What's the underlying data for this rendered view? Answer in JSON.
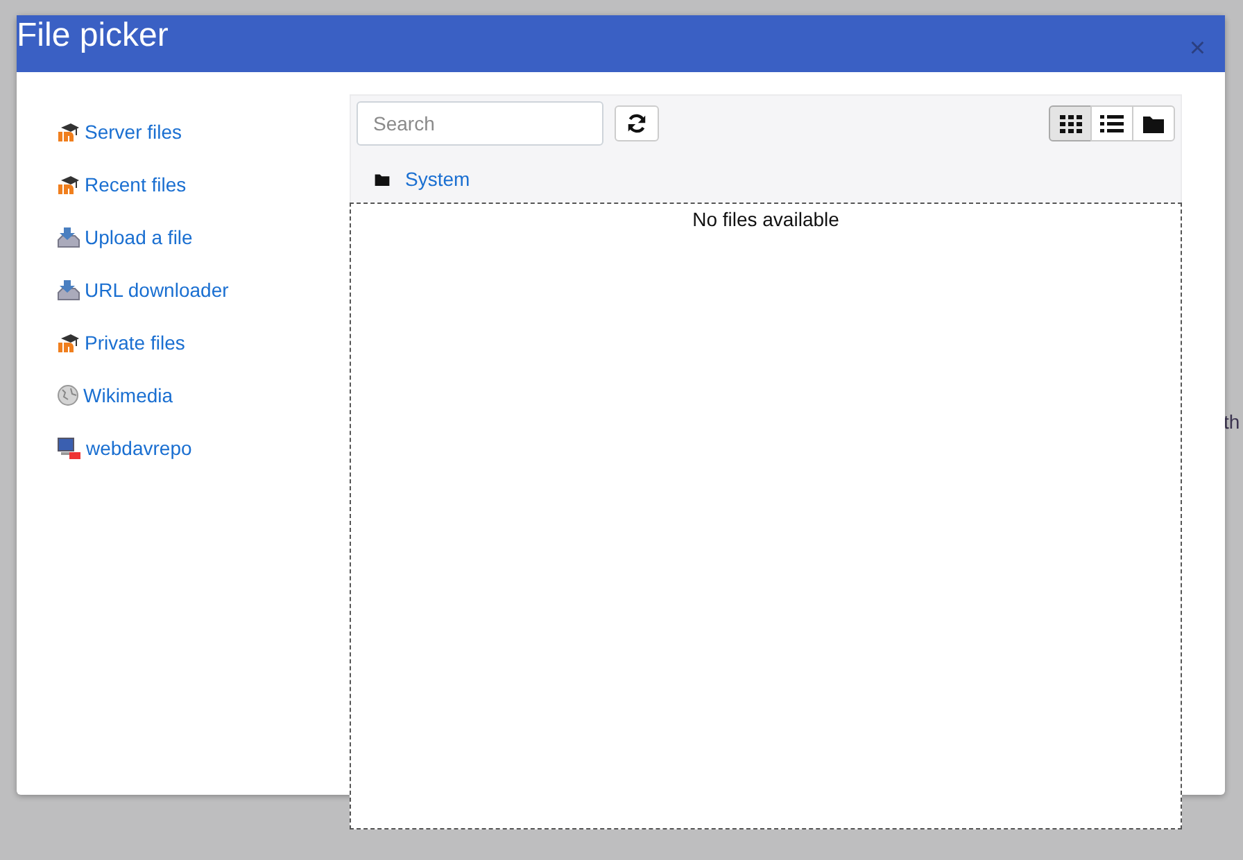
{
  "background": {
    "right_text": "th"
  },
  "dialog": {
    "title": "File picker",
    "close": "×",
    "repositories": [
      {
        "label": "Server files",
        "kind": "moodle"
      },
      {
        "label": "Recent files",
        "kind": "moodle"
      },
      {
        "label": "Upload a file",
        "kind": "upload"
      },
      {
        "label": "URL downloader",
        "kind": "upload"
      },
      {
        "label": "Private files",
        "kind": "moodle"
      },
      {
        "label": "Wikimedia",
        "kind": "wikimedia"
      },
      {
        "label": "webdavrepo",
        "kind": "webdav"
      }
    ],
    "search": {
      "placeholder": "Search"
    },
    "view_modes": [
      {
        "kind": "icons",
        "selected": true
      },
      {
        "kind": "list",
        "selected": false
      },
      {
        "kind": "tree",
        "selected": false
      }
    ],
    "path": [
      {
        "label": "System"
      }
    ],
    "empty_message": "No files available"
  }
}
